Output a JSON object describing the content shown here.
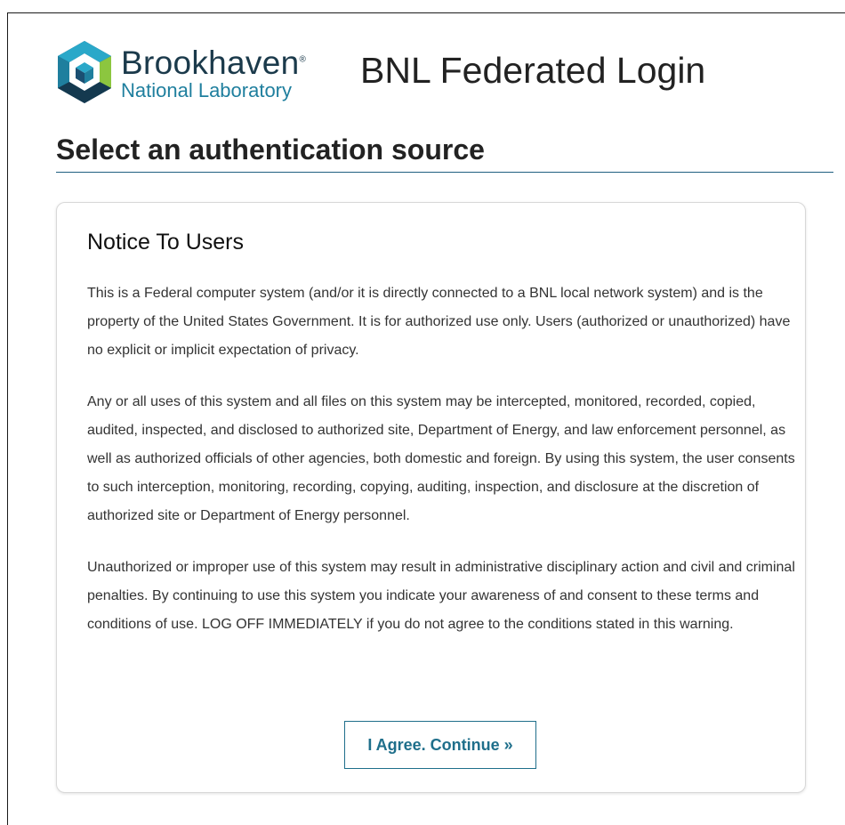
{
  "branding": {
    "logo_name": "Brookhaven",
    "logo_registered": "®",
    "logo_subtitle": "National Laboratory",
    "colors": {
      "logo_dark_blue": "#1b3a4b",
      "logo_teal": "#1f7f9e",
      "logo_green": "#8cc63f"
    }
  },
  "header": {
    "app_title": "BNL Federated Login"
  },
  "page": {
    "heading": "Select an authentication source"
  },
  "notice": {
    "title": "Notice To Users",
    "paragraphs": [
      "This is a Federal computer system (and/or it is directly connected to a BNL local network system) and is the property of the United States Government. It is for authorized use only. Users (authorized or unauthorized) have no explicit or implicit expectation of privacy.",
      "Any or all uses of this system and all files on this system may be intercepted, monitored, recorded, copied, audited, inspected, and disclosed to authorized site, Department of Energy, and law enforcement personnel, as well as authorized officials of other agencies, both domestic and foreign. By using this system, the user consents to such interception, monitoring, recording, copying, auditing, inspection, and disclosure at the discretion of authorized site or Department of Energy personnel.",
      "Unauthorized or improper use of this system may result in administrative disciplinary action and civil and criminal penalties. By continuing to use this system you indicate your awareness of and consent to these terms and conditions of use. LOG OFF IMMEDIATELY if you do not agree to the conditions stated in this warning."
    ],
    "agree_button_label": "I Agree. Continue »"
  },
  "icons": {
    "logo": "brookhaven-cube-logo-icon"
  },
  "colors": {
    "accent": "#1f6f8b",
    "heading_rule": "#1f5f80",
    "card_border": "#d8d8d8"
  }
}
